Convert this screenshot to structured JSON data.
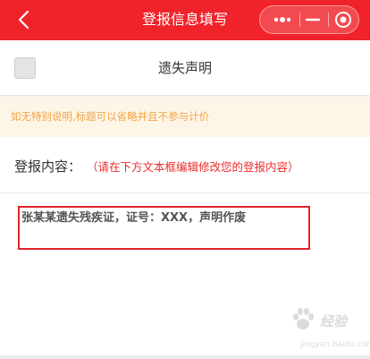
{
  "nav": {
    "title": "登报信息填写",
    "back_icon": "chevron-left-icon",
    "more_icon": "more-dots-icon",
    "minimize_icon": "minimize-icon",
    "close_icon": "target-close-icon"
  },
  "option": {
    "label": "遗失声明",
    "checked": false
  },
  "notice": {
    "text": "如无特别说明,标题可以省略并且不参与计价"
  },
  "content": {
    "label": "登报内容：",
    "hint": "（请在下方文本框编辑修改您的登报内容）",
    "value": "张某某遗失残疾证，证号：XXX，声明作废"
  },
  "watermark": {
    "brand": "经验",
    "url": "jingyan.baidu.com"
  },
  "colors": {
    "accent": "#f0232a",
    "notice_bg": "#fdf6e7",
    "notice_text": "#f3a344",
    "hint_text": "#ee2b2b"
  }
}
